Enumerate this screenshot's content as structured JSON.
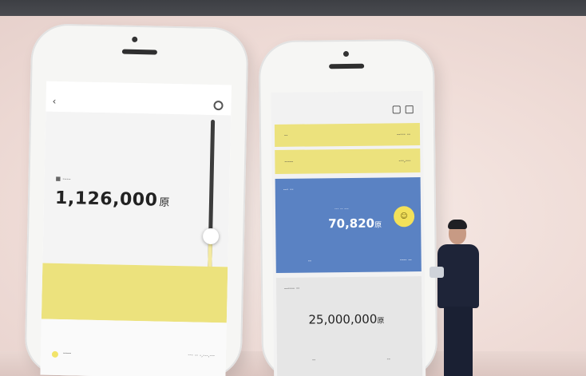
{
  "left_phone": {
    "label": "■ ----",
    "amount": "1,126,000",
    "currency": "原",
    "bottom_left": "----",
    "bottom_right": "--- -- -,---,---"
  },
  "right_phone": {
    "row1_left": "--",
    "row1_right": "----- --",
    "row2_left": "-----",
    "row2_right": "---,---",
    "blue_title": "--- --",
    "blue_sub": "--- -- ---",
    "blue_amount": "70,820",
    "currency": "原",
    "coin_label": "☺",
    "blue_bottom_left": "--",
    "blue_bottom_right": "---- --",
    "card3_title": "------ --",
    "card3_amount": "25,000,000",
    "card3_bottom_left": "--",
    "card3_bottom_right": "--"
  }
}
